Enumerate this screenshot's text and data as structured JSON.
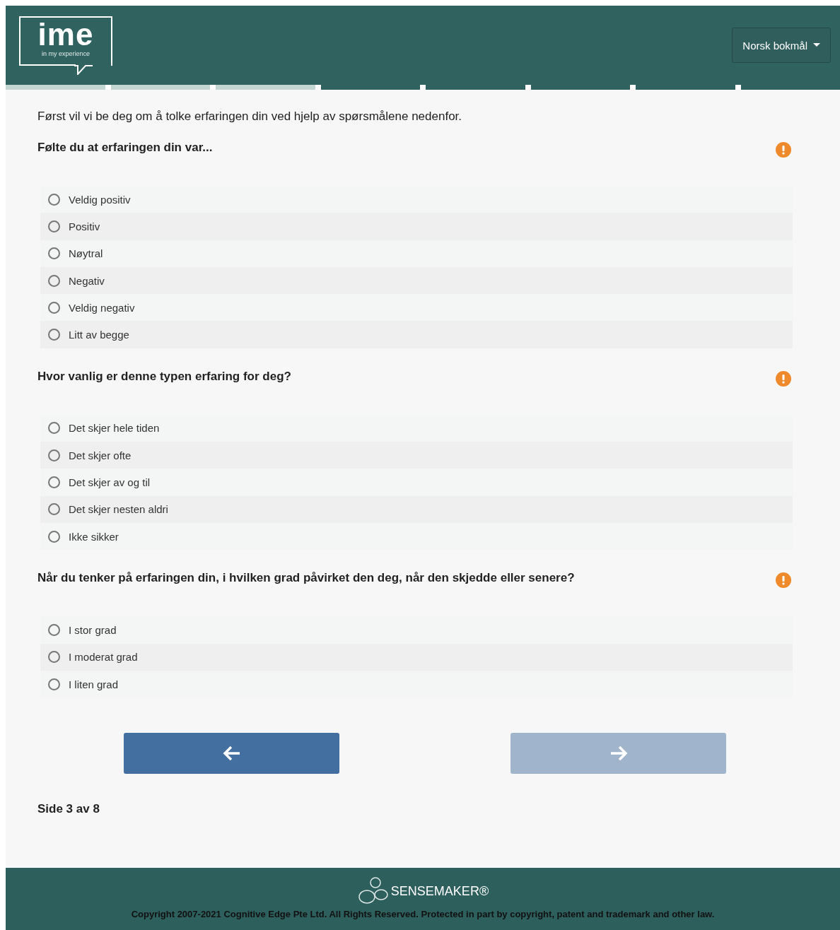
{
  "header": {
    "logo": {
      "word": "ime",
      "tagline": "in my experience"
    },
    "language": "Norsk bokmål"
  },
  "progress": [
    {
      "done": true
    },
    {
      "done": true
    },
    {
      "done": true
    },
    {
      "done": false
    },
    {
      "done": false
    },
    {
      "done": false
    },
    {
      "done": false
    },
    {
      "done": false
    }
  ],
  "intro": "Først vil vi be deg om å tolke erfaringen din ved hjelp av spørsmålene nedenfor.",
  "questions": [
    {
      "title": "Følte du at erfaringen din var...",
      "required": true,
      "options": [
        {
          "label": "Veldig positiv",
          "selected": false
        },
        {
          "label": "Positiv",
          "selected": false
        },
        {
          "label": "Nøytral",
          "selected": false
        },
        {
          "label": "Negativ",
          "selected": false
        },
        {
          "label": "Veldig negativ",
          "selected": false
        },
        {
          "label": "Litt av begge",
          "selected": false
        }
      ]
    },
    {
      "title": "Hvor vanlig er denne typen erfaring for deg?",
      "required": true,
      "options": [
        {
          "label": "Det skjer hele tiden",
          "selected": false
        },
        {
          "label": "Det skjer ofte",
          "selected": false
        },
        {
          "label": "Det skjer av og til",
          "selected": false
        },
        {
          "label": "Det skjer nesten aldri",
          "selected": false
        },
        {
          "label": "Ikke sikker",
          "selected": false
        }
      ]
    },
    {
      "title": "Når du tenker på erfaringen din, i hvilken grad påvirket den deg, når den skjedde eller senere?",
      "required": true,
      "options": [
        {
          "label": "I stor grad",
          "selected": false
        },
        {
          "label": "I moderat grad",
          "selected": false
        },
        {
          "label": "I liten grad",
          "selected": false
        }
      ]
    }
  ],
  "nav": {
    "back": {
      "disabled": false
    },
    "next": {
      "disabled": true
    }
  },
  "page_indicator": "Side 3 av 8",
  "footer": {
    "brand": "SENSEMAKER®",
    "copyright": "Copyright 2007-2021 Cognitive Edge Pte Ltd. All Rights Reserved. Protected in part by copyright, patent and trademark and other law."
  }
}
